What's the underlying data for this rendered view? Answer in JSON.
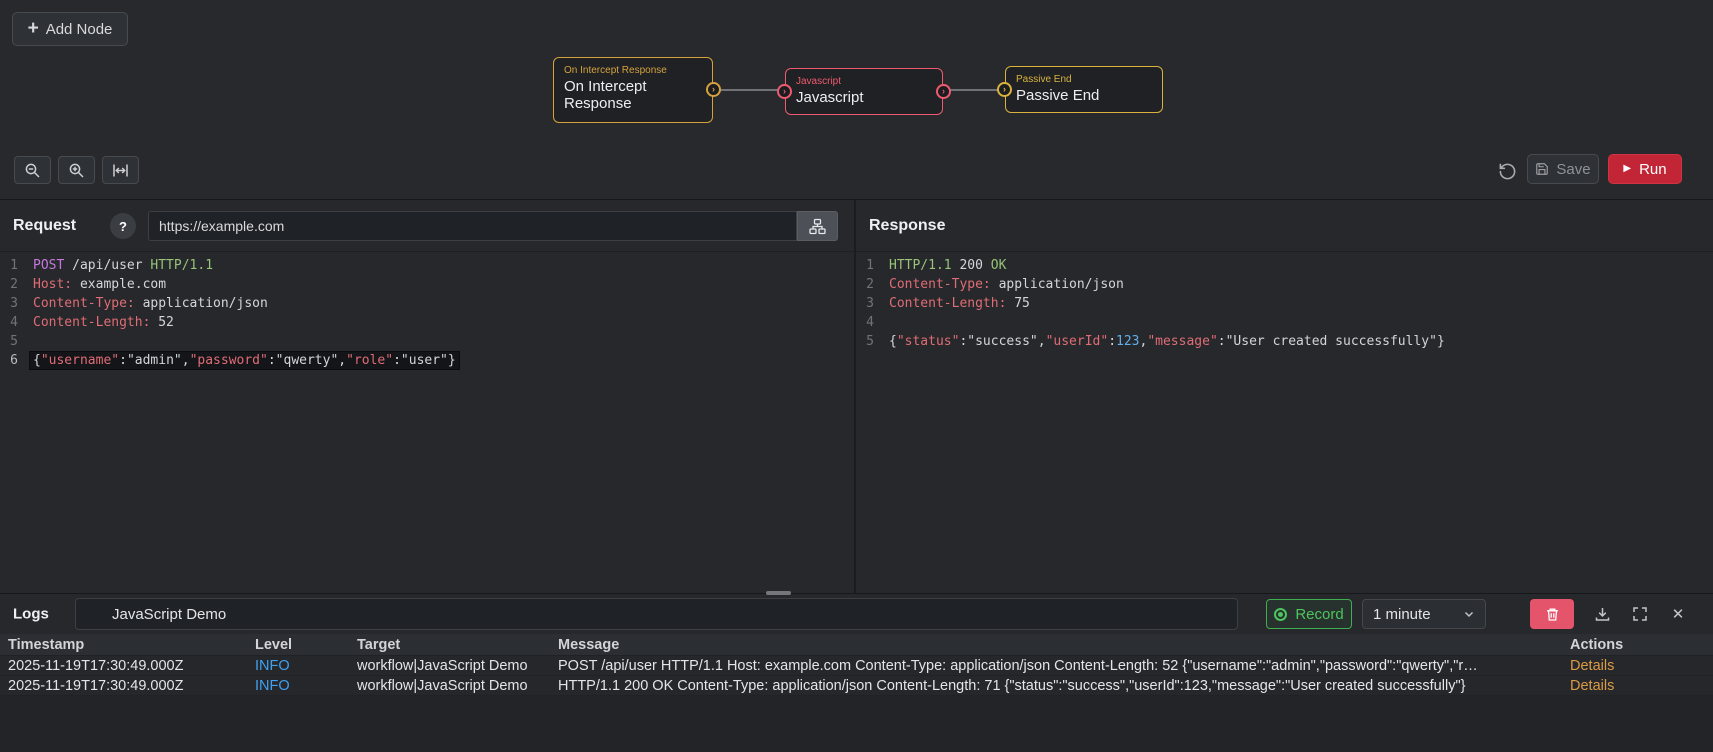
{
  "icons": {
    "plus": "+",
    "play": "▶",
    "close": "✕",
    "port_arrow": "›",
    "chevron": "⌄"
  },
  "canvas": {
    "add_node_label": "Add Node",
    "nodes": [
      {
        "type_label": "On Intercept Response",
        "title": "On Intercept Response",
        "color": "#d6a23e"
      },
      {
        "type_label": "Javascript",
        "title": "Javascript",
        "color": "#ef5b6e"
      },
      {
        "type_label": "Passive End",
        "title": "Passive End",
        "color": "#d9b33e"
      }
    ],
    "toolbar": {
      "save_label": "Save",
      "run_label": "Run"
    }
  },
  "request": {
    "title": "Request",
    "help_label": "?",
    "url_value": "https://example.com",
    "editor": {
      "lines": [
        {
          "n": 1,
          "s": [
            {
              "t": "POST",
              "c": "kw"
            },
            {
              "t": " /api/user ",
              "c": "plain"
            },
            {
              "t": "HTTP/1.1",
              "c": "atom"
            }
          ]
        },
        {
          "n": 2,
          "s": [
            {
              "t": "Host:",
              "c": "hdr"
            },
            {
              "t": " example.com",
              "c": "plain"
            }
          ]
        },
        {
          "n": 3,
          "s": [
            {
              "t": "Content-Type:",
              "c": "hdr"
            },
            {
              "t": " application/json",
              "c": "plain"
            }
          ]
        },
        {
          "n": 4,
          "s": [
            {
              "t": "Content-Length:",
              "c": "hdr"
            },
            {
              "t": " 52",
              "c": "plain"
            }
          ]
        },
        {
          "n": 5,
          "s": []
        },
        {
          "n": 6,
          "a": true,
          "s": [
            {
              "t": "{",
              "c": "plain"
            },
            {
              "t": "\"username\"",
              "c": "key"
            },
            {
              "t": ":",
              "c": "plain"
            },
            {
              "t": "\"admin\"",
              "c": "str"
            },
            {
              "t": ",",
              "c": "plain"
            },
            {
              "t": "\"password\"",
              "c": "key"
            },
            {
              "t": ":",
              "c": "plain"
            },
            {
              "t": "\"qwerty\"",
              "c": "str"
            },
            {
              "t": ",",
              "c": "plain"
            },
            {
              "t": "\"role\"",
              "c": "key"
            },
            {
              "t": ":",
              "c": "plain"
            },
            {
              "t": "\"user\"",
              "c": "str"
            },
            {
              "t": "}",
              "c": "plain"
            }
          ]
        }
      ]
    }
  },
  "response": {
    "title": "Response",
    "editor": {
      "lines": [
        {
          "n": 1,
          "s": [
            {
              "t": "HTTP/1.1",
              "c": "atom"
            },
            {
              "t": " 200 ",
              "c": "plain"
            },
            {
              "t": "OK",
              "c": "atom"
            }
          ]
        },
        {
          "n": 2,
          "s": [
            {
              "t": "Content-Type:",
              "c": "hdr"
            },
            {
              "t": " application/json",
              "c": "plain"
            }
          ]
        },
        {
          "n": 3,
          "s": [
            {
              "t": "Content-Length:",
              "c": "hdr"
            },
            {
              "t": " 75",
              "c": "plain"
            }
          ]
        },
        {
          "n": 4,
          "s": []
        },
        {
          "n": 5,
          "s": [
            {
              "t": "{",
              "c": "plain"
            },
            {
              "t": "\"status\"",
              "c": "key"
            },
            {
              "t": ":",
              "c": "plain"
            },
            {
              "t": "\"success\"",
              "c": "str"
            },
            {
              "t": ",",
              "c": "plain"
            },
            {
              "t": "\"userId\"",
              "c": "key"
            },
            {
              "t": ":",
              "c": "plain"
            },
            {
              "t": "123",
              "c": "num"
            },
            {
              "t": ",",
              "c": "plain"
            },
            {
              "t": "\"message\"",
              "c": "key"
            },
            {
              "t": ":",
              "c": "plain"
            },
            {
              "t": "\"User created successfully\"",
              "c": "str"
            },
            {
              "t": "}",
              "c": "plain"
            }
          ]
        }
      ]
    }
  },
  "logs": {
    "title": "Logs",
    "search_value": "JavaScript Demo",
    "record_label": "Record",
    "interval_value": "1 minute",
    "columns": [
      "Timestamp",
      "Level",
      "Target",
      "Message",
      "Actions"
    ],
    "rows": [
      {
        "timestamp": "2025-11-19T17:30:49.000Z",
        "level": "INFO",
        "target": "workflow|JavaScript Demo",
        "message": "POST /api/user HTTP/1.1 Host: example.com Content-Type: application/json Content-Length: 52 {\"username\":\"admin\",\"password\":\"qwerty\",\"r…",
        "action": "Details"
      },
      {
        "timestamp": "2025-11-19T17:30:49.000Z",
        "level": "INFO",
        "target": "workflow|JavaScript Demo",
        "message": "HTTP/1.1 200 OK Content-Type: application/json Content-Length: 71 {\"status\":\"success\",\"userId\":123,\"message\":\"User created successfully\"}",
        "action": "Details"
      }
    ]
  },
  "colors": {
    "run_red": "#c22535",
    "record_green": "#4ec45e",
    "info_blue": "#41a0f0",
    "details_orange": "#dc9b45",
    "trash_red": "#e4556b",
    "node_orange": "#d6a23e",
    "node_red": "#ef5b6e",
    "node_yellow": "#d9b33e"
  }
}
